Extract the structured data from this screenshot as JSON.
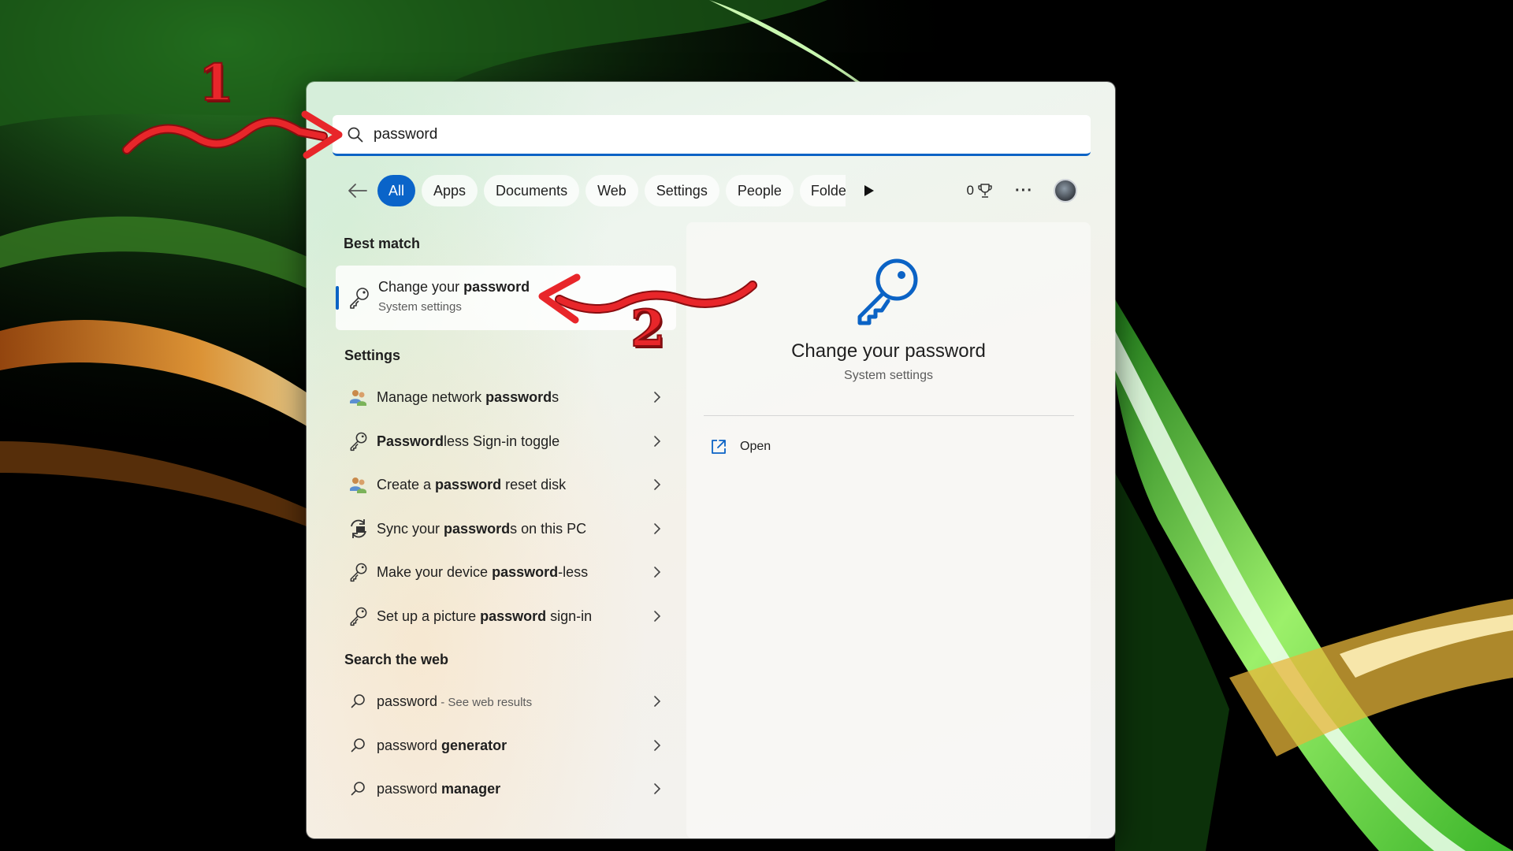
{
  "search": {
    "query": "password"
  },
  "filters": [
    "All",
    "Apps",
    "Documents",
    "Web",
    "Settings",
    "People",
    "Folders"
  ],
  "toolbar": {
    "points": "0",
    "more_label": "···"
  },
  "best_match": {
    "heading": "Best match",
    "title_pre": "Change your ",
    "title_bold": "password",
    "subtitle": "System settings"
  },
  "settings": {
    "heading": "Settings",
    "items": [
      {
        "pre": "Manage network ",
        "bold": "password",
        "post": "s",
        "icon": "network-users-icon"
      },
      {
        "pre": "",
        "bold": "Password",
        "post": "less Sign-in toggle",
        "icon": "key-icon"
      },
      {
        "pre": "Create a ",
        "bold": "password",
        "post": " reset disk",
        "icon": "network-users-icon"
      },
      {
        "pre": "Sync your ",
        "bold": "password",
        "post": "s on this PC",
        "icon": "sync-pc-icon"
      },
      {
        "pre": "Make your device ",
        "bold": "password",
        "post": "-less",
        "icon": "key-icon"
      },
      {
        "pre": "Set up a picture ",
        "bold": "password",
        "post": " sign-in",
        "icon": "key-icon"
      }
    ]
  },
  "web": {
    "heading": "Search the web",
    "items": [
      {
        "pre": "password",
        "bold": "",
        "hint": " - See web results"
      },
      {
        "pre": "password ",
        "bold": "generator",
        "hint": ""
      },
      {
        "pre": "password ",
        "bold": "manager",
        "hint": ""
      }
    ]
  },
  "preview": {
    "title": "Change your password",
    "subtitle": "System settings",
    "open_label": "Open"
  },
  "annotations": {
    "step1": "1",
    "step2": "2"
  },
  "colors": {
    "accent": "#0b63c5",
    "annotation": "#e8262a"
  }
}
